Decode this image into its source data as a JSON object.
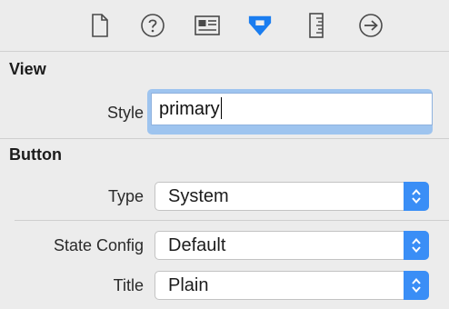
{
  "toolbar": {
    "tabs": [
      {
        "name": "file-inspector-icon",
        "active": false
      },
      {
        "name": "quick-help-icon",
        "active": false
      },
      {
        "name": "identity-inspector-icon",
        "active": false
      },
      {
        "name": "attributes-inspector-icon",
        "active": true
      },
      {
        "name": "size-inspector-icon",
        "active": false
      },
      {
        "name": "connections-inspector-icon",
        "active": false
      }
    ],
    "active_color": "#1a7df0",
    "inactive_color": "#4a4a4a"
  },
  "view_section": {
    "title": "View",
    "style_label": "Style",
    "style_value": "primary"
  },
  "button_section": {
    "title": "Button",
    "type_label": "Type",
    "type_value": "System",
    "state_config_label": "State Config",
    "state_config_value": "Default",
    "title_label": "Title",
    "title_value": "Plain"
  },
  "colors": {
    "accent": "#3a8ef6",
    "focus_ring": "#9ec4ef",
    "panel_bg": "#ececec"
  }
}
